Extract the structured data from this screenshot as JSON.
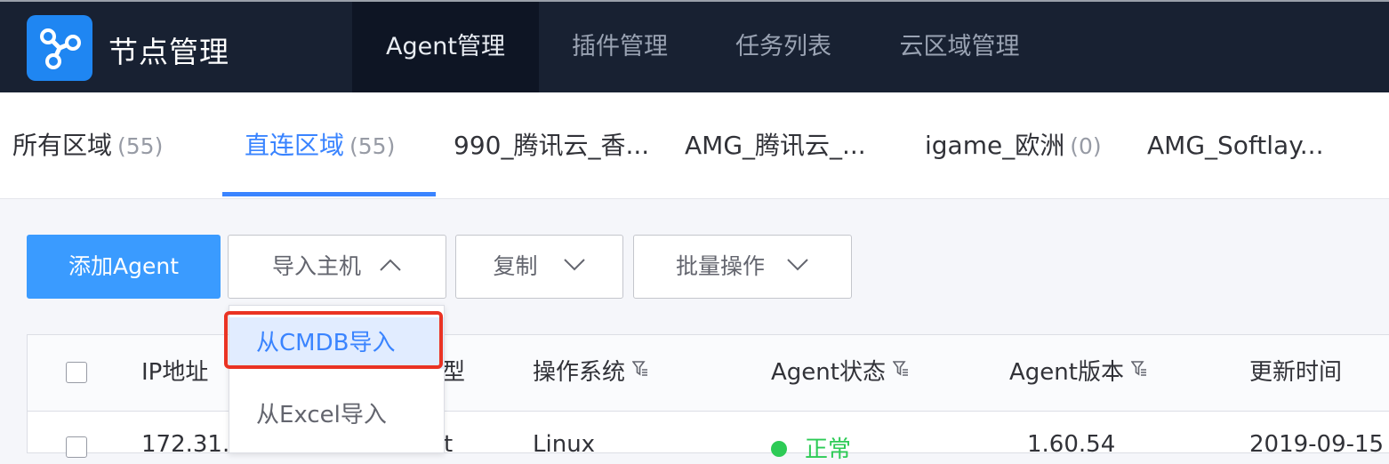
{
  "header": {
    "app_title": "节点管理",
    "nav": [
      {
        "label": "Agent管理",
        "active": true
      },
      {
        "label": "插件管理",
        "active": false
      },
      {
        "label": "任务列表",
        "active": false
      },
      {
        "label": "云区域管理",
        "active": false
      }
    ]
  },
  "region_tabs": [
    {
      "label": "所有区域",
      "count": "(55)",
      "active": false
    },
    {
      "label": "直连区域",
      "count": "(55)",
      "active": true
    },
    {
      "label": "990_腾讯云_香...",
      "count": "",
      "active": false
    },
    {
      "label": "AMG_腾讯云_...",
      "count": "",
      "active": false
    },
    {
      "label": "igame_欧洲",
      "count": "(0)",
      "active": false
    },
    {
      "label": "AMG_Softlay...",
      "count": "",
      "active": false
    }
  ],
  "toolbar": {
    "add_agent": "添加Agent",
    "import_host": "导入主机",
    "copy": "复制",
    "batch_ops": "批量操作"
  },
  "import_menu": {
    "items": [
      {
        "label": "从CMDB导入",
        "highlighted": true
      },
      {
        "label": "从Excel导入",
        "highlighted": false
      }
    ]
  },
  "table": {
    "columns": [
      "IP地址",
      "类型",
      "操作系统",
      "Agent状态",
      "Agent版本",
      "更新时间"
    ],
    "rows": [
      {
        "ip": "172.31.",
        "type": "t",
        "os": "Linux",
        "status": "正常",
        "version": "1.60.54",
        "updated": "2019-09-15"
      }
    ]
  },
  "colors": {
    "nav_bg": "#182132",
    "accent": "#3a84ff",
    "primary_button": "#3a9bff",
    "status_ok": "#2dcb56",
    "annotation_red": "#ea3323"
  },
  "icons": [
    "app-logo-icon",
    "chevron-up-icon",
    "chevron-down-icon",
    "filter-icon"
  ]
}
